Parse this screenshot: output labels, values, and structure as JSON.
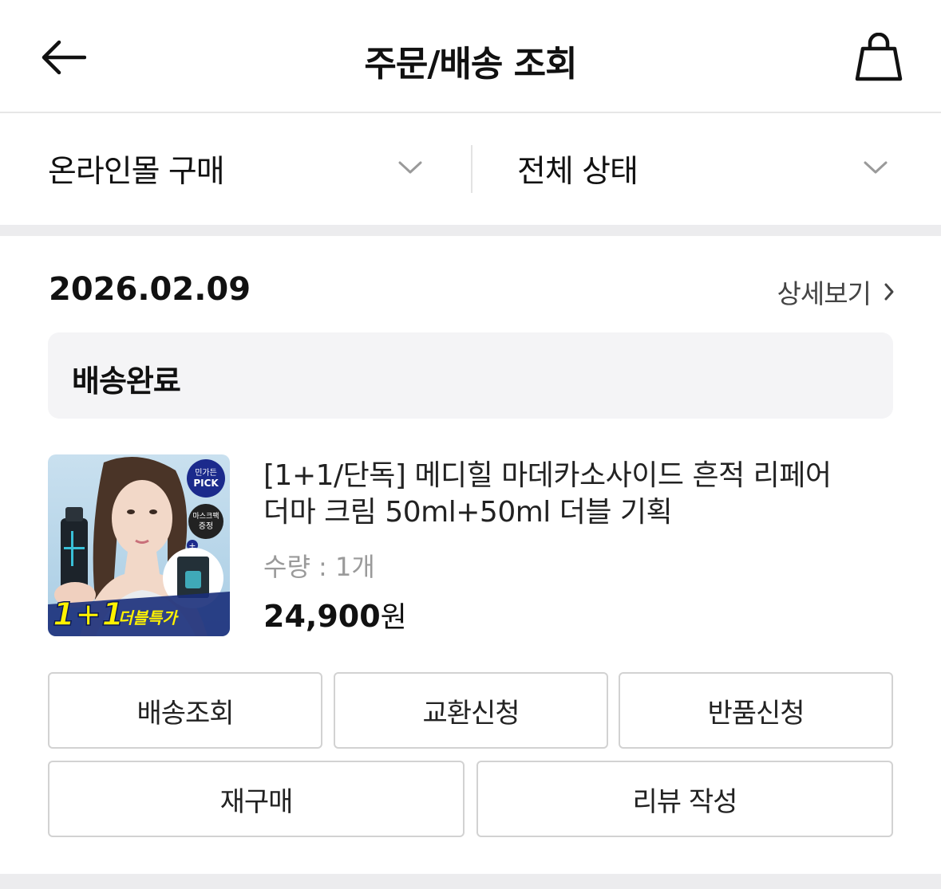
{
  "header": {
    "title": "주문/배송 조회",
    "back_icon": "arrow-left-icon",
    "bag_icon": "shopping-bag-icon"
  },
  "filters": {
    "channel": "온라인몰 구매",
    "status": "전체 상태"
  },
  "order": {
    "date": "2026.02.09",
    "detail_link": "상세보기",
    "status": "배송완료",
    "product": {
      "name": "[1+1/단독] 메디힐 마데카소사이드 흔적 리페어 더마 크림 50ml+50ml 더블 기획",
      "quantity": "수량 : 1개",
      "price": "24,900",
      "currency": "원",
      "image_badge_top_line1": "민가든",
      "image_badge_top_line2": "PICK",
      "image_badge_gift_line1": "마스크팩",
      "image_badge_gift_line2": "증정",
      "image_promo_big": "1+1",
      "image_promo_small": "더블특가"
    },
    "actions": {
      "track": "배송조회",
      "exchange": "교환신청",
      "return": "반품신청",
      "reorder": "재구매",
      "review": "리뷰 작성"
    }
  },
  "colors": {
    "band": "#ececee",
    "status_bg": "#f4f4f6",
    "badge_navy": "#1b2a8c",
    "thumb_bg": "#bcd8ea",
    "promo_yellow": "#fff200"
  }
}
